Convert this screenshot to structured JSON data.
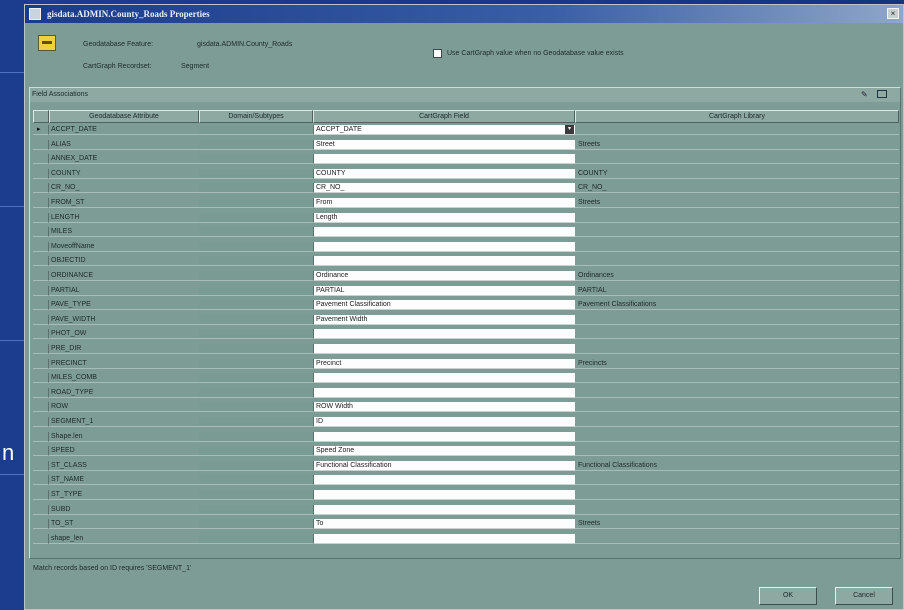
{
  "window": {
    "title": "gisdata.ADMIN.County_Roads Properties",
    "close_glyph": "×"
  },
  "header": {
    "geodatabase_label": "Geodatabase Feature:",
    "geodatabase_value": "gisdata.ADMIN.County_Roads",
    "cartograph_label": "CartGraph Recordset:",
    "cartograph_value": "Segment",
    "checkbox_label": "Use CartGraph value when no Geodatabase value exists"
  },
  "field_associations": {
    "title": "Field Associations"
  },
  "table": {
    "columns": [
      "Geodatabase Attribute",
      "Domain/Subtypes",
      "CartGraph Field",
      "CartGraph Library"
    ],
    "rows": [
      {
        "geo": "ACCPT_DATE",
        "cg": "ACCPT_DATE",
        "lib": "",
        "selected": true
      },
      {
        "geo": "ALIAS",
        "cg": "Street",
        "lib": "Streets"
      },
      {
        "geo": "ANNEX_DATE",
        "cg": "",
        "lib": ""
      },
      {
        "geo": "COUNTY",
        "cg": "COUNTY",
        "lib": "COUNTY"
      },
      {
        "geo": "CR_NO_",
        "cg": "CR_NO_",
        "lib": "CR_NO_"
      },
      {
        "geo": "FROM_ST",
        "cg": "From",
        "lib": "Streets"
      },
      {
        "geo": "LENGTH",
        "cg": "Length",
        "lib": ""
      },
      {
        "geo": "MILES",
        "cg": "",
        "lib": ""
      },
      {
        "geo": "MoveoffName",
        "cg": "",
        "lib": ""
      },
      {
        "geo": "OBJECTID",
        "cg": "",
        "lib": ""
      },
      {
        "geo": "ORDINANCE",
        "cg": "Ordinance",
        "lib": "Ordinances"
      },
      {
        "geo": "PARTIAL",
        "cg": "PARTIAL",
        "lib": "PARTIAL"
      },
      {
        "geo": "PAVE_TYPE",
        "cg": "Pavement Classification",
        "lib": "Pavement Classifications"
      },
      {
        "geo": "PAVE_WIDTH",
        "cg": "Pavement Width",
        "lib": ""
      },
      {
        "geo": "PHOT_OW",
        "cg": "",
        "lib": ""
      },
      {
        "geo": "PRE_DIR",
        "cg": "",
        "lib": ""
      },
      {
        "geo": "PRECINCT",
        "cg": "Precinct",
        "lib": "Precincts"
      },
      {
        "geo": "MILES_COMB",
        "cg": "",
        "lib": ""
      },
      {
        "geo": "ROAD_TYPE",
        "cg": "",
        "lib": ""
      },
      {
        "geo": "ROW",
        "cg": "ROW Width",
        "lib": ""
      },
      {
        "geo": "SEGMENT_1",
        "cg": "ID",
        "lib": ""
      },
      {
        "geo": "Shape.len",
        "cg": "",
        "lib": ""
      },
      {
        "geo": "SPEED",
        "cg": "Speed Zone",
        "lib": ""
      },
      {
        "geo": "ST_CLASS",
        "cg": "Functional Classification",
        "lib": "Functional Classifications"
      },
      {
        "geo": "ST_NAME",
        "cg": "",
        "lib": ""
      },
      {
        "geo": "ST_TYPE",
        "cg": "",
        "lib": ""
      },
      {
        "geo": "SUBD",
        "cg": "",
        "lib": ""
      },
      {
        "geo": "TO_ST",
        "cg": "To",
        "lib": "Streets"
      },
      {
        "geo": "shape_len",
        "cg": "",
        "lib": ""
      }
    ]
  },
  "status": "Match records based on ID requires 'SEGMENT_1'",
  "buttons": {
    "ok": "OK",
    "cancel": "Cancel"
  },
  "slide_text": "n"
}
